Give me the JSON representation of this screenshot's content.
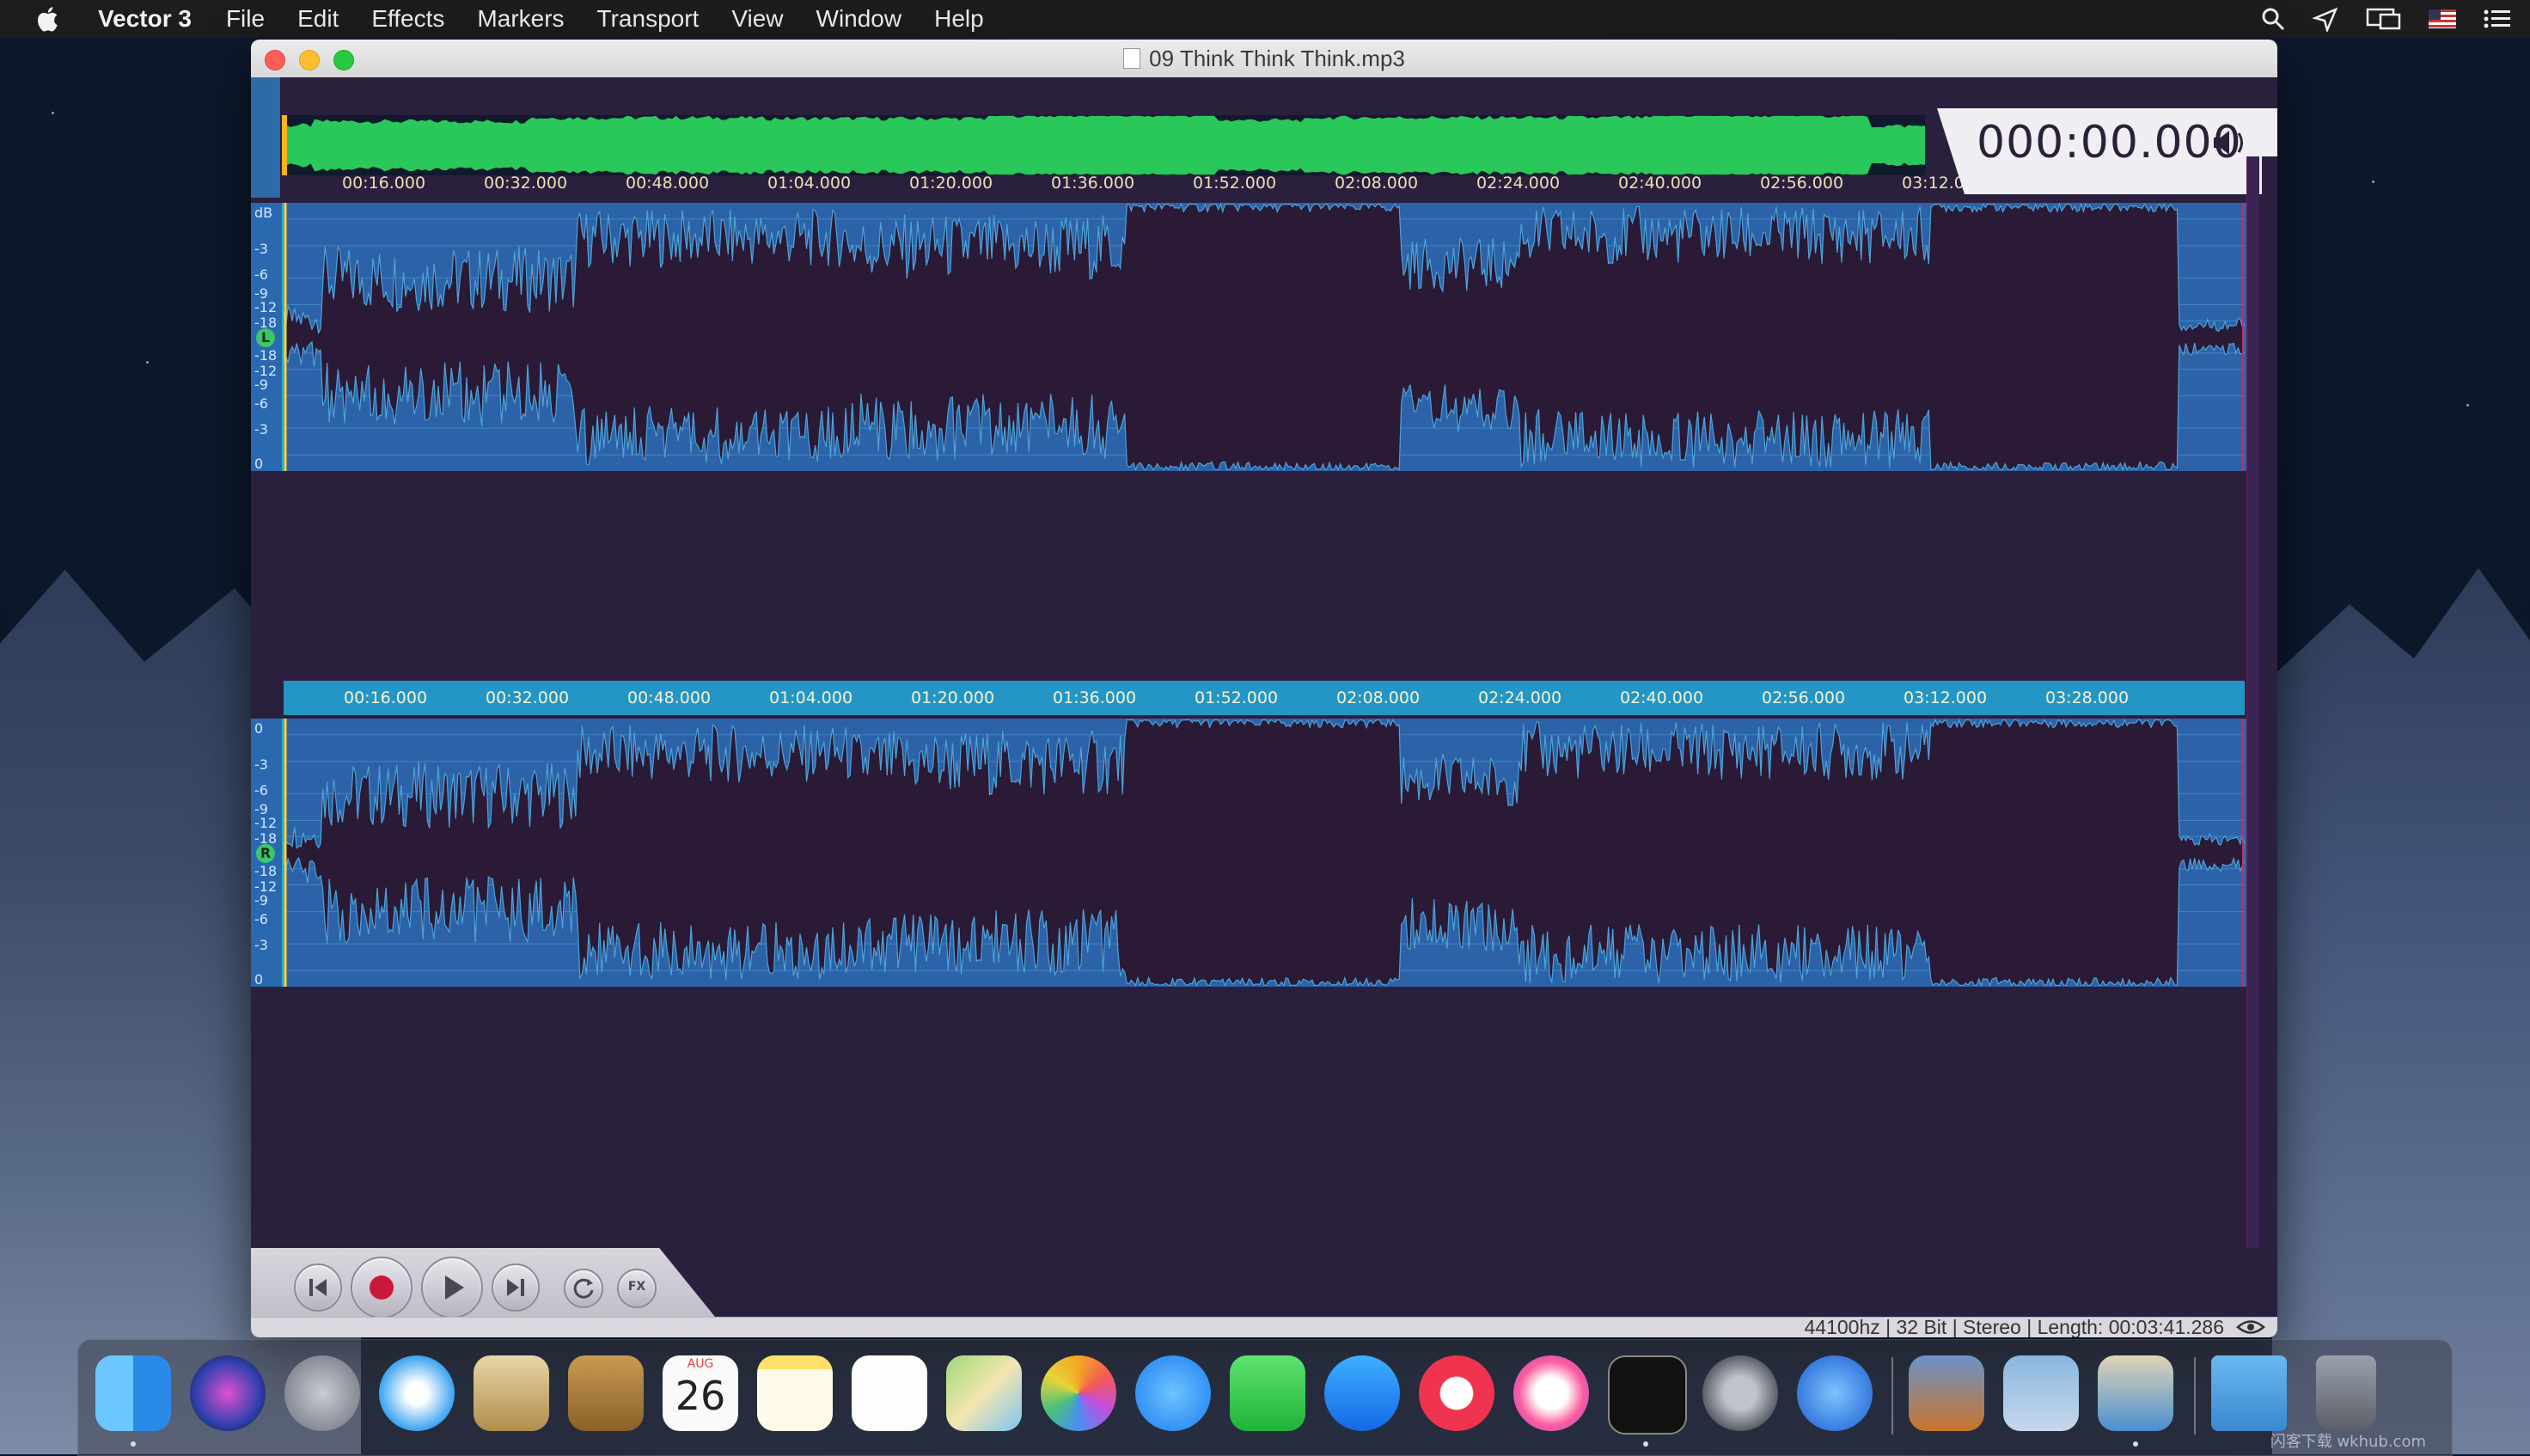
{
  "menubar": {
    "app_name": "Vector 3",
    "items": [
      "File",
      "Edit",
      "Effects",
      "Markers",
      "Transport",
      "View",
      "Window",
      "Help"
    ],
    "status_icons": [
      "search-icon",
      "location-icon",
      "display-icon",
      "us-flag-icon",
      "list-icon"
    ]
  },
  "window": {
    "title": "09 Think Think Think.mp3",
    "time_display": "000:00.000"
  },
  "ruler": {
    "labels": [
      "00:16.000",
      "00:32.000",
      "00:48.000",
      "01:04.000",
      "01:20.000",
      "01:36.000",
      "01:52.000",
      "02:08.000",
      "02:24.000",
      "02:40.000",
      "02:56.000",
      "03:12.000",
      "03:28.000"
    ]
  },
  "channels": {
    "left": {
      "badge": "L",
      "db_top": [
        "dB",
        "-3",
        "-6",
        "-9",
        "-12",
        "-18"
      ],
      "db_bottom": [
        "-18",
        "-12",
        "-9",
        "-6",
        "-3",
        "0"
      ]
    },
    "right": {
      "badge": "R",
      "db_top": [
        "0",
        "-3",
        "-6",
        "-9",
        "-12",
        "-18"
      ],
      "db_bottom": [
        "-18",
        "-12",
        "-9",
        "-6",
        "-3",
        "0"
      ]
    }
  },
  "transport": {
    "buttons": [
      "skip-back",
      "record",
      "play",
      "skip-forward",
      "loop",
      "fx"
    ],
    "fx_label": "FX"
  },
  "status": {
    "text": "44100hz | 32 Bit | Stereo | Length: 00:03:41.286"
  },
  "dock": {
    "apps": [
      "Finder",
      "Siri",
      "Launchpad",
      "Safari",
      "Mail",
      "Contacts",
      "Calendar",
      "Notes",
      "Reminders",
      "Maps",
      "Photos",
      "Messages",
      "FaceTime",
      "App Store",
      "News",
      "iTunes",
      "Terminal",
      "System Preferences",
      "Vector",
      "Archive Utility",
      "Preview",
      "Audio App",
      "Folder",
      "Trash"
    ],
    "calendar_month": "AUG",
    "calendar_day": "26",
    "watermark": "闪客下载 wkhub.com"
  },
  "colors": {
    "wave_bg": "#2c63a8",
    "wave_fill": "#2a1a36",
    "accent_teal": "#22b4cc",
    "overview_green": "#2ac75a",
    "time_text": "#2c2037"
  }
}
